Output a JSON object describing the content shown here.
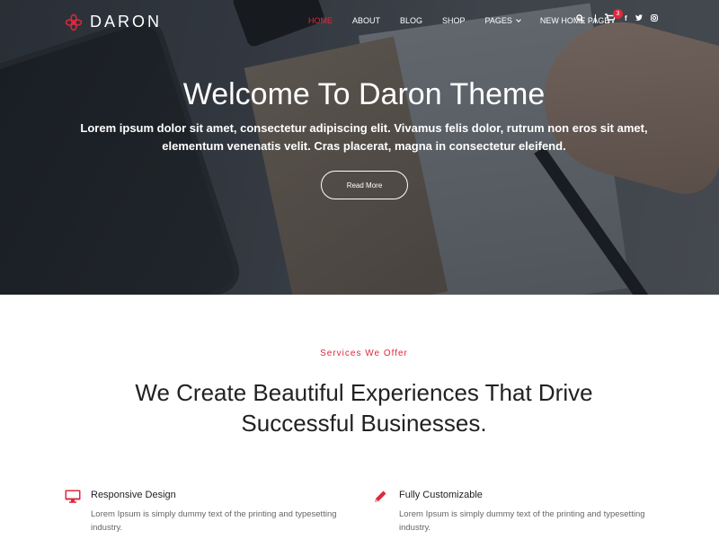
{
  "brand": {
    "name": "DARON",
    "accent": "#e0283c"
  },
  "nav": {
    "items": [
      {
        "label": "HOME",
        "active": true
      },
      {
        "label": "ABOUT",
        "active": false
      },
      {
        "label": "BLOG",
        "active": false
      },
      {
        "label": "SHOP",
        "active": false
      },
      {
        "label": "PAGES",
        "active": false
      },
      {
        "label": "NEW HOME PAGE",
        "active": false
      }
    ]
  },
  "tools": {
    "search_icon": "search-icon",
    "cart_icon": "cart-icon",
    "cart_count": "3",
    "social": [
      "f",
      "t",
      "i"
    ]
  },
  "hero": {
    "title": "Welcome To Daron Theme",
    "subtitle": "Lorem ipsum dolor sit amet, consectetur adipiscing elit. Vivamus felis dolor, rutrum non eros sit amet, elementum venenatis velit. Cras placerat, magna in consectetur eleifend.",
    "button": "Read More"
  },
  "services": {
    "kicker": "Services We Offer",
    "title": "We Create Beautiful Experiences That Drive Successful Businesses.",
    "features": [
      {
        "icon": "monitor-icon",
        "title": "Responsive Design",
        "text": "Lorem Ipsum is simply dummy text of the printing and typesetting industry."
      },
      {
        "icon": "pencil-icon",
        "title": "Fully Customizable",
        "text": "Lorem Ipsum is simply dummy text of the printing and typesetting industry."
      }
    ]
  }
}
